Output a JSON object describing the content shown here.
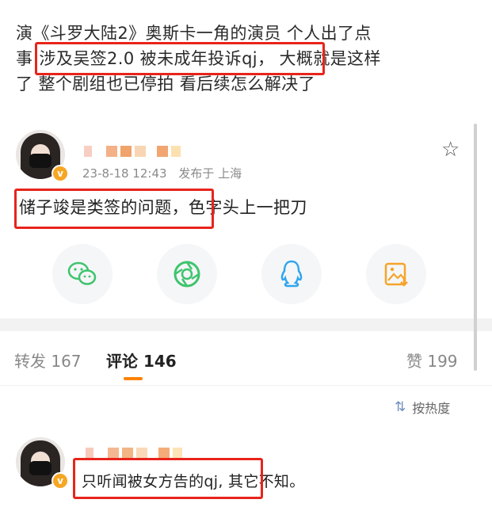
{
  "post": {
    "line1": "演《斗罗大陆2》奥斯卡一角的演员 个人出了点",
    "line2_prefix": "事",
    "line2_highlight": "涉及吴签2.0 被未成年投诉qj，",
    "line2_suffix": "大概就是这样",
    "line3": "了 整个剧组也已停拍 看后续怎么解决了"
  },
  "author_post": {
    "timestamp": "23-8-18 12:43",
    "location": "发布于 上海",
    "verified_badge": "v",
    "comment_highlight": "储子竣是类签的问题，",
    "comment_rest": "色字头上一把刀"
  },
  "share_buttons": [
    {
      "name": "wechat-icon"
    },
    {
      "name": "moments-icon"
    },
    {
      "name": "qq-icon"
    },
    {
      "name": "save-image-icon"
    }
  ],
  "tabs": {
    "repost": "转发 167",
    "comments": "评论 146",
    "likes": "赞 199"
  },
  "sort": {
    "label": "按热度"
  },
  "reply": {
    "verified_badge": "v",
    "text_highlight": "只听闻被女方告的qj,",
    "text_rest": " 其它不知。"
  },
  "colors": {
    "highlight_border": "#e8241b",
    "tab_accent": "#ff8200",
    "badge": "#f6a623"
  }
}
